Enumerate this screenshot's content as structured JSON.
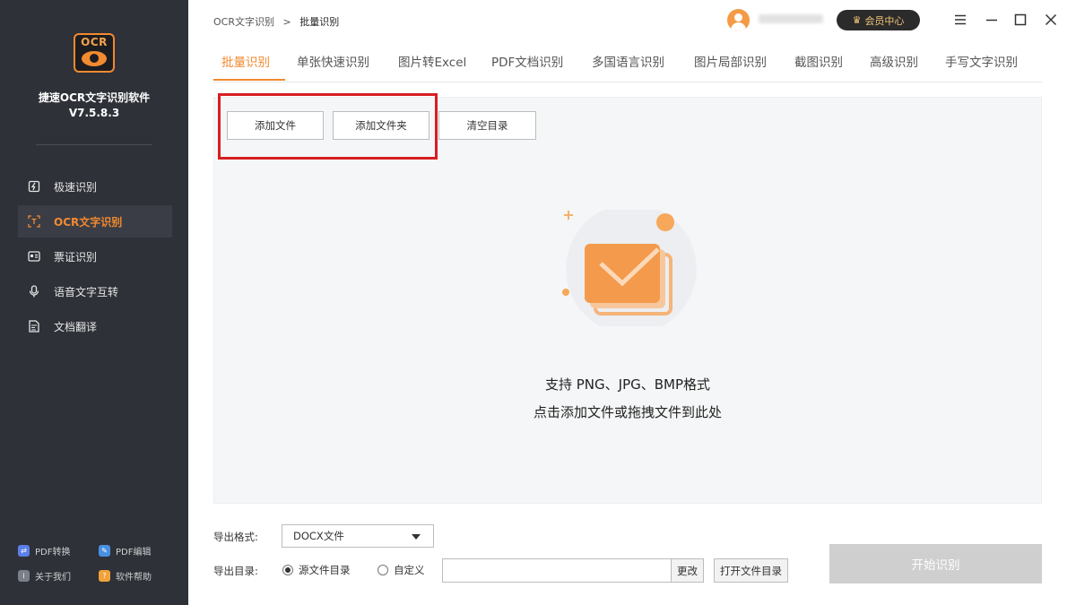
{
  "sidebar": {
    "logo_text": "OCR",
    "app_name": "捷速OCR文字识别软件",
    "version": "V7.5.8.3",
    "items": [
      {
        "label": "极速识别",
        "icon": "lightning-doc-icon",
        "active": false
      },
      {
        "label": "OCR文字识别",
        "icon": "text-scan-icon",
        "active": true
      },
      {
        "label": "票证识别",
        "icon": "id-card-icon",
        "active": false
      },
      {
        "label": "语音文字互转",
        "icon": "microphone-icon",
        "active": false
      },
      {
        "label": "文档翻译",
        "icon": "document-translate-icon",
        "active": false
      }
    ],
    "bottom_links": [
      {
        "label": "PDF转换",
        "icon": "pdf-convert-icon",
        "color": "#5b7fe8"
      },
      {
        "label": "PDF编辑",
        "icon": "pdf-edit-icon",
        "color": "#4a90e2"
      },
      {
        "label": "关于我们",
        "icon": "info-icon",
        "color": "#7a7f8a"
      },
      {
        "label": "软件帮助",
        "icon": "help-icon",
        "color": "#f2a23a"
      }
    ]
  },
  "header": {
    "breadcrumb": {
      "parent": "OCR文字识别",
      "separator": ">",
      "current": "批量识别"
    },
    "vip_label": "会员中心"
  },
  "tabs": [
    {
      "label": "批量识别",
      "active": true
    },
    {
      "label": "单张快速识别",
      "active": false
    },
    {
      "label": "图片转Excel",
      "active": false
    },
    {
      "label": "PDF文档识别",
      "active": false
    },
    {
      "label": "多国语言识别",
      "active": false
    },
    {
      "label": "图片局部识别",
      "active": false
    },
    {
      "label": "截图识别",
      "active": false
    },
    {
      "label": "高级识别",
      "active": false
    },
    {
      "label": "手写文字识别",
      "active": false
    }
  ],
  "toolbar": {
    "add_file": "添加文件",
    "add_folder": "添加文件夹",
    "clear_list": "清空目录"
  },
  "dropzone": {
    "line1": "支持 PNG、JPG、BMP格式",
    "line2": "点击添加文件或拖拽文件到此处"
  },
  "options": {
    "format_label": "导出格式:",
    "format_value": "DOCX文件",
    "dir_label": "导出目录:",
    "radio_source": "源文件目录",
    "radio_custom": "自定义",
    "path_value": "",
    "change_label": "更改",
    "open_dir_label": "打开文件目录",
    "start_label": "开始识别"
  },
  "colors": {
    "accent": "#f28a30",
    "sidebar_bg": "#2e3138",
    "highlight": "#d81e23"
  }
}
